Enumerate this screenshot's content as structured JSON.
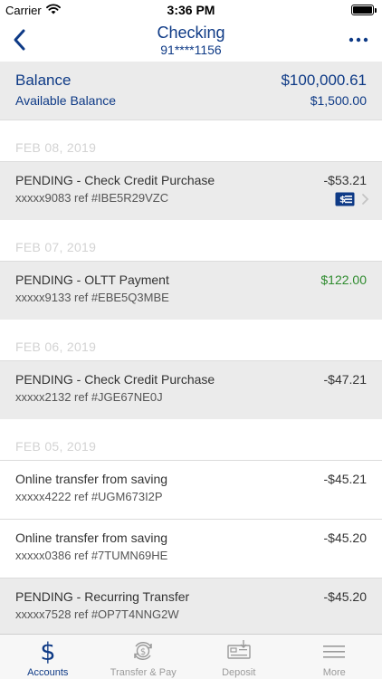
{
  "status_bar": {
    "carrier": "Carrier",
    "time": "3:36 PM"
  },
  "header": {
    "title": "Checking",
    "account_number": "91****1156",
    "back_icon": "chevron-left-icon",
    "menu_icon": "more-dots-icon"
  },
  "balance": {
    "label": "Balance",
    "value": "$100,000.61",
    "available_label": "Available Balance",
    "available_value": "$1,500.00"
  },
  "groups": [
    {
      "date": "FEB 08, 2019",
      "transactions": [
        {
          "description": "PENDING - Check Credit Purchase",
          "reference": "xxxxx9083 ref #IBE5R29VZC",
          "amount": "-$53.21",
          "pending": true,
          "has_check_image": true
        }
      ]
    },
    {
      "date": "FEB 07, 2019",
      "transactions": [
        {
          "description": "PENDING - OLTT Payment",
          "reference": "xxxxx9133 ref #EBE5Q3MBE",
          "amount": "$122.00",
          "pending": true,
          "credit": true
        }
      ]
    },
    {
      "date": "FEB 06, 2019",
      "transactions": [
        {
          "description": "PENDING - Check Credit Purchase",
          "reference": "xxxxx2132 ref #JGE67NE0J",
          "amount": "-$47.21",
          "pending": true
        }
      ]
    },
    {
      "date": "FEB 05, 2019",
      "transactions": [
        {
          "description": "Online transfer from saving",
          "reference": "xxxxx4222 ref #UGM673I2P",
          "amount": "-$45.21",
          "pending": false
        },
        {
          "description": "Online transfer from saving",
          "reference": "xxxxx0386 ref #7TUMN69HE",
          "amount": "-$45.20",
          "pending": false
        },
        {
          "description": "PENDING - Recurring Transfer",
          "reference": "xxxxx7528 ref #OP7T4NNG2W",
          "amount": "-$45.20",
          "pending": true
        }
      ]
    }
  ],
  "tabs": [
    {
      "label": "Accounts",
      "icon": "dollar-icon",
      "active": true
    },
    {
      "label": "Transfer & Pay",
      "icon": "transfer-icon",
      "active": false
    },
    {
      "label": "Deposit",
      "icon": "deposit-check-icon",
      "active": false
    },
    {
      "label": "More",
      "icon": "menu-icon",
      "active": false
    }
  ],
  "colors": {
    "brand": "#0e3a86",
    "credit": "#2e8b2e",
    "pending_bg": "#ebebeb",
    "inactive_tab": "#9a9a9a"
  }
}
